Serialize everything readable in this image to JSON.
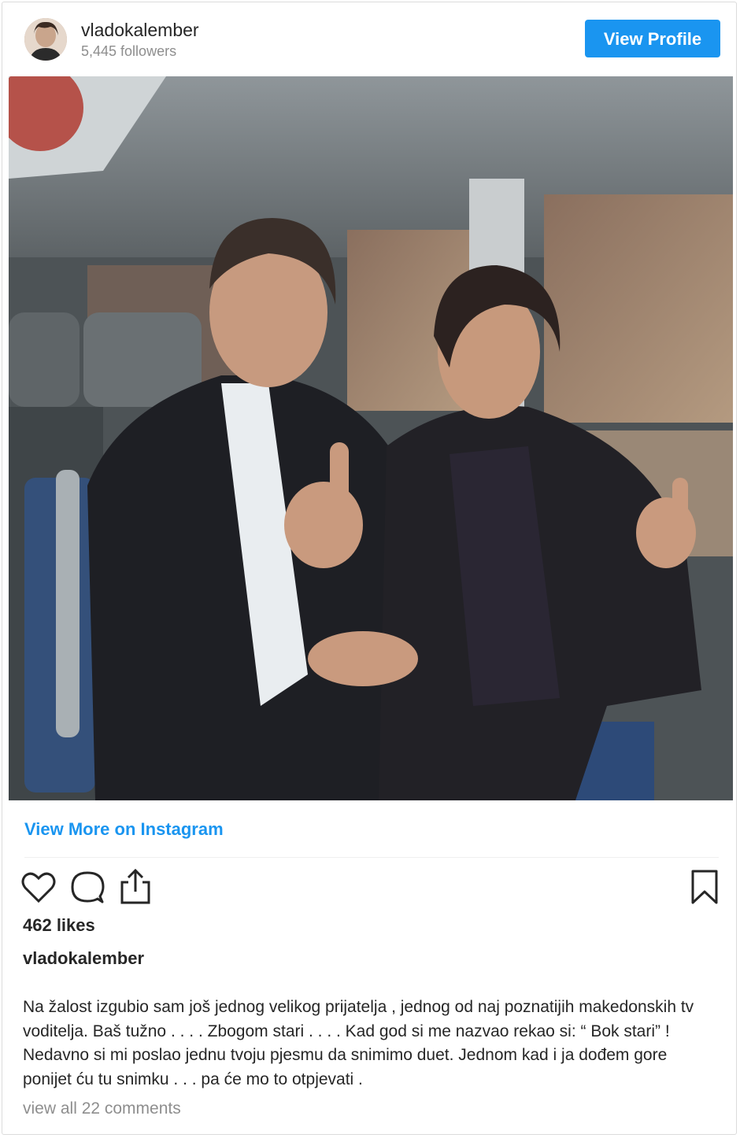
{
  "header": {
    "username": "vladokalember",
    "followers": "5,445 followers",
    "view_profile_label": "View Profile"
  },
  "post": {
    "photo_description_icon": "post-photo",
    "view_more_label": "View More on Instagram",
    "likes": "462 likes",
    "caption_username": "vladokalember",
    "caption": "Na žalost izgubio sam još jednog velikog prijatelja , jednog od naj poznatijih makedonskih tv voditelja. Baš tužno . . . . Zbogom stari . . . . Kad god si me nazvao rekao si: “ Bok stari” ! Nedavno si mi poslao jednu tvoju pjesmu da snimimo duet. Jednom kad i ja dođem gore ponijet ću tu snimku . . . pa će mo to otpjevati .",
    "comments_link": "view all 22 comments"
  },
  "actions": {
    "like_icon": "heart-icon",
    "comment_icon": "comment-icon",
    "share_icon": "share-icon",
    "save_icon": "bookmark-icon"
  },
  "colors": {
    "accent": "#1a95f0",
    "text": "#262626",
    "muted": "#8e8e8e",
    "border": "#dbdbdb"
  }
}
